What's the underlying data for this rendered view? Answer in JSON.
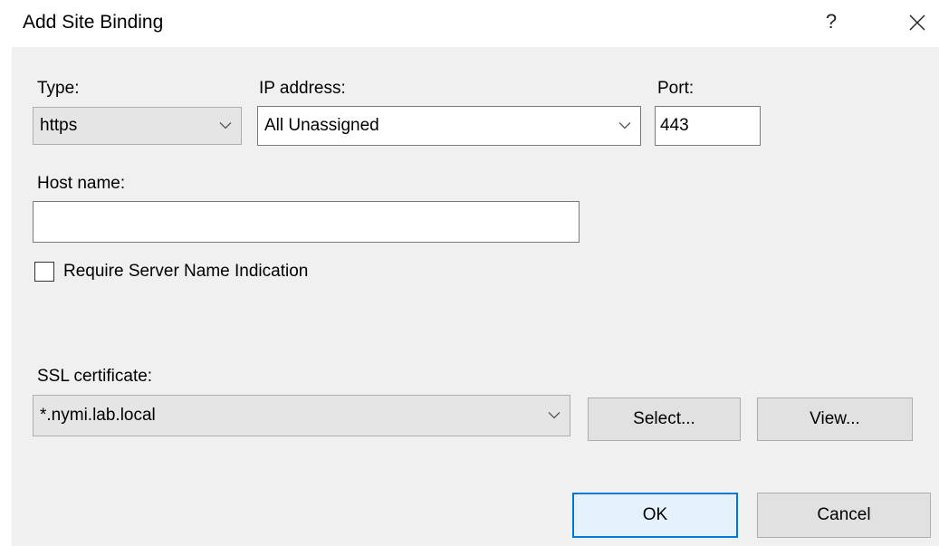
{
  "window": {
    "title": "Add Site Binding",
    "help_label": "?",
    "close_icon": "close-icon"
  },
  "type": {
    "label": "Type:",
    "value": "https"
  },
  "ip_address": {
    "label": "IP address:",
    "value": "All Unassigned"
  },
  "port": {
    "label": "Port:",
    "value": "443"
  },
  "host_name": {
    "label": "Host name:",
    "value": ""
  },
  "sni": {
    "label": "Require Server Name Indication",
    "checked": false
  },
  "ssl_certificate": {
    "label": "SSL certificate:",
    "value": "*.nymi.lab.local",
    "select_label": "Select...",
    "view_label": "View..."
  },
  "actions": {
    "ok_label": "OK",
    "cancel_label": "Cancel"
  },
  "colors": {
    "dialog_background": "#f0f0f0",
    "default_button_border": "#0078d7",
    "default_button_fill": "#e5f1fb"
  }
}
